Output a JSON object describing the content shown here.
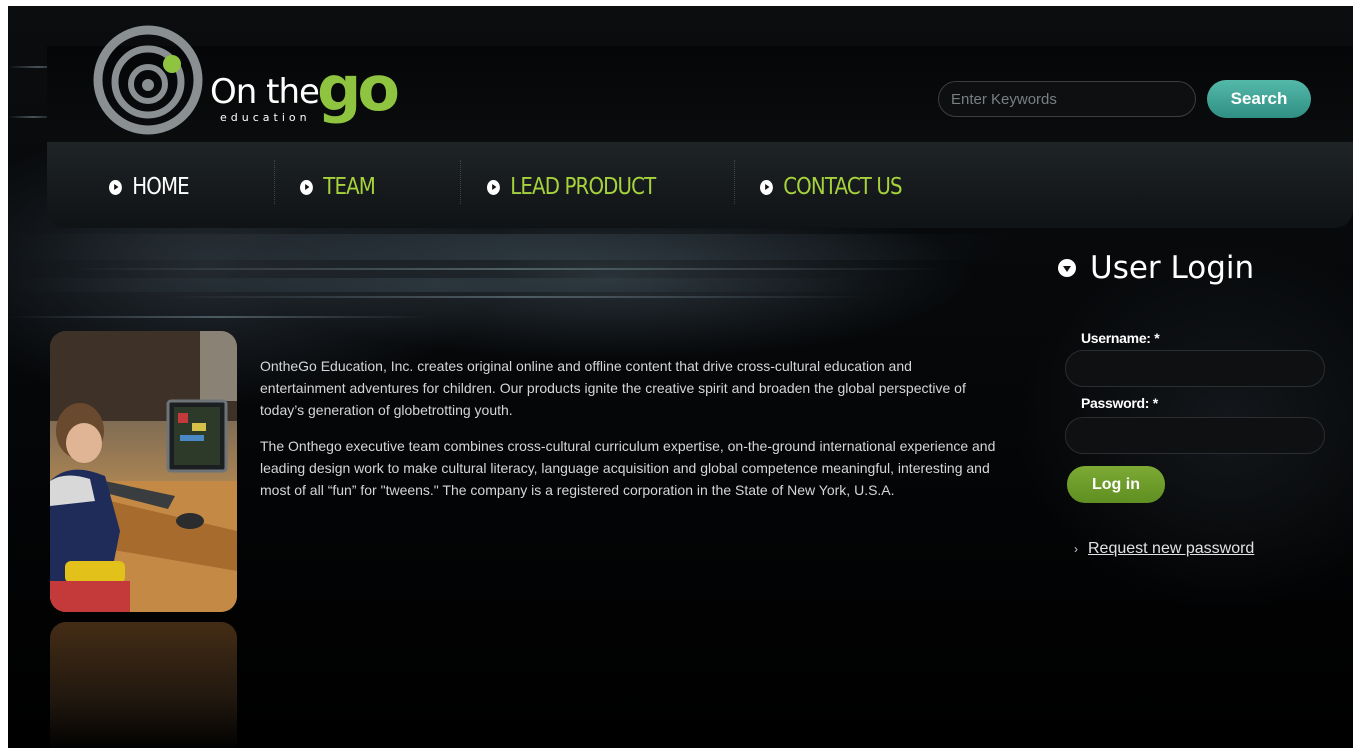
{
  "header": {
    "logo": {
      "main": "On the",
      "sub": "education",
      "go": "go"
    },
    "search": {
      "placeholder": "Enter Keywords",
      "value": "",
      "button_label": "Search"
    }
  },
  "nav": {
    "items": [
      {
        "label": "HOME",
        "color": "#ffffff"
      },
      {
        "label": "TEAM",
        "color": "#a6d23c"
      },
      {
        "label": "LEAD PRODUCT",
        "color": "#a6d23c"
      },
      {
        "label": "CONTACT US",
        "color": "#a6d23c"
      }
    ]
  },
  "content": {
    "paragraphs": [
      "OntheGo Education, Inc. creates original online and offline content that drive cross-cultural education and entertainment adventures for children. Our products ignite the creative spirit and broaden the global perspective of today’s generation of globetrotting youth.",
      "The Onthego executive team combines cross-cultural curriculum expertise, on-the-ground international experience and leading design work to make cultural literacy, language acquisition and global competence meaningful, interesting and most of all “fun” for \"tweens.\" The company is a registered corporation in the State of New York, U.S.A."
    ]
  },
  "login": {
    "title": "User Login",
    "username_label": "Username: *",
    "username_value": "",
    "password_label": "Password: *",
    "password_value": "",
    "submit_label": "Log in",
    "request_password_label": "Request new password"
  },
  "colors": {
    "accent_green": "#8fc440",
    "nav_green": "#a6d23c",
    "search_teal": "#3aa294",
    "login_green": "#6e9c2b"
  }
}
